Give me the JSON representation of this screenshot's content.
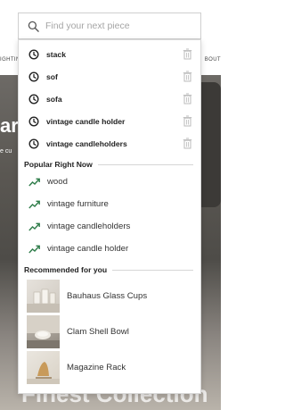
{
  "background": {
    "nav_left": "IGHTING",
    "nav_right": "BOUT",
    "hero_title": "ar",
    "hero_sub": "e cu",
    "hero_bottom": "Finest Collection"
  },
  "search": {
    "placeholder": "Find your next piece"
  },
  "recent": [
    {
      "label": "stack"
    },
    {
      "label": "sof"
    },
    {
      "label": "sofa"
    },
    {
      "label": "vintage candle holder"
    },
    {
      "label": "vintage candleholders"
    }
  ],
  "popular": {
    "heading": "Popular Right Now",
    "items": [
      {
        "label": "wood"
      },
      {
        "label": "vintage furniture"
      },
      {
        "label": "vintage candleholders"
      },
      {
        "label": "vintage candle holder"
      }
    ]
  },
  "recommended": {
    "heading": "Recommended for you",
    "items": [
      {
        "label": "Bauhaus Glass Cups",
        "image": "glass-cups-photo"
      },
      {
        "label": "Clam Shell Bowl",
        "image": "shell-bowl-photo"
      },
      {
        "label": "Magazine Rack",
        "image": "magazine-rack-photo"
      }
    ]
  },
  "colors": {
    "trend_icon": "#2f7d4a",
    "text": "#222222"
  }
}
